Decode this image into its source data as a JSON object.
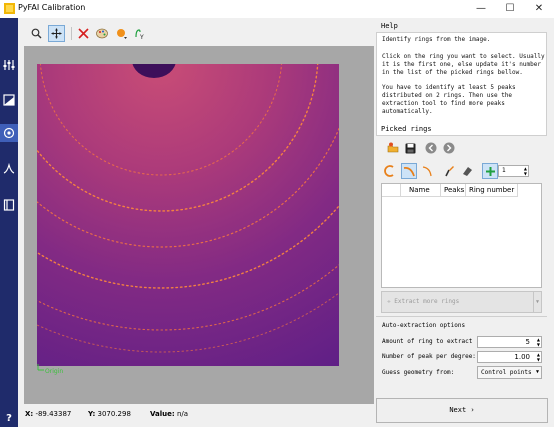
{
  "window": {
    "title": "PyFAI Calibration",
    "minimize": "—",
    "maximize": "☐",
    "close": "✕",
    "icon": "pyfai-app-icon"
  },
  "sidebar": {
    "items": [
      {
        "name": "experiment-settings",
        "icon": "sliders-icon"
      },
      {
        "name": "mask",
        "icon": "image-mask-icon"
      },
      {
        "name": "peak-picking",
        "icon": "peak-picking-icon",
        "active": true
      },
      {
        "name": "geometry",
        "icon": "geometry-icon"
      },
      {
        "name": "integrate",
        "icon": "integrate-icon"
      }
    ],
    "help_label": "?"
  },
  "plot_toolbar": {
    "tools": [
      "zoom-icon",
      "pan-icon",
      "reset-icon",
      "colormap-icon",
      "marker-icon",
      "scale-icon"
    ]
  },
  "plot": {
    "origin_label": "Origin",
    "ring_color": "#ff6a2a",
    "beam_stop_color": "#3d0f5a"
  },
  "status": {
    "x_label": "X:",
    "x_value": "-89.43387",
    "y_label": "Y:",
    "y_value": "3070.298",
    "value_label": "Value:",
    "value_value": "n/a"
  },
  "help": {
    "title": "Help",
    "lines": [
      "Identify rings from the image.",
      "",
      "Click on the ring you want to select. Usually",
      "it is the first one, else update it's number",
      "in the list of the picked rings bellow.",
      "",
      "You have to identify at least 5 peaks",
      "distributed on 2 rings. Then use the",
      "extraction tool to find more peaks",
      "automatically."
    ]
  },
  "picked_rings": {
    "title": "Picked rings",
    "ring_spin_value": "1",
    "columns": [
      "Name",
      "Peaks",
      "Ring number"
    ],
    "extract_button": "Extract more rings"
  },
  "auto_extraction": {
    "title": "Auto-extraction options",
    "amount_label": "Amount of ring to extract",
    "amount_value": "5",
    "peaks_label": "Number of peak per degree:",
    "peaks_value": "1.00",
    "guess_label": "Guess geometry from:",
    "guess_value": "Control points"
  },
  "next_button": "Next ›"
}
